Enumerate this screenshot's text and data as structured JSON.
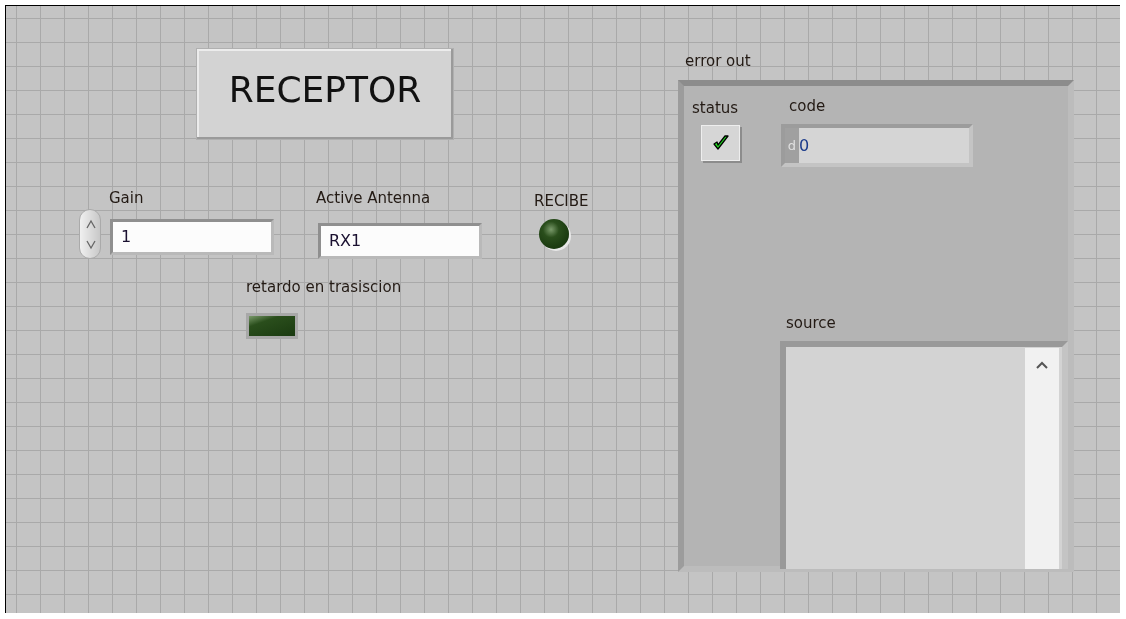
{
  "button": {
    "label": "RECEPTOR"
  },
  "gain": {
    "label": "Gain",
    "value": "1"
  },
  "antenna": {
    "label": "Active Antenna",
    "value": "RX1"
  },
  "leds": [
    {
      "label": "RECIBE",
      "kind": "round",
      "on": false
    },
    {
      "label": "retardo en trasiscion",
      "kind": "square",
      "on": false
    }
  ],
  "error_out": {
    "label": "error out",
    "status": {
      "label": "status",
      "error": false
    },
    "code": {
      "label": "code",
      "radix": "d",
      "value": "0"
    },
    "source": {
      "label": "source"
    }
  }
}
